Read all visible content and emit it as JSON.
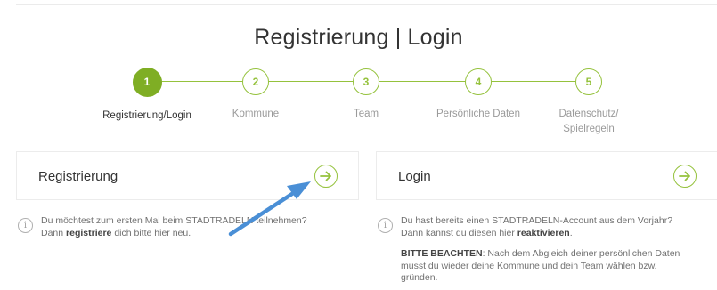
{
  "page": {
    "title": "Registrierung | Login"
  },
  "stepper": {
    "steps": [
      {
        "number": "1",
        "label": "Registrierung/Login",
        "active": true
      },
      {
        "number": "2",
        "label": "Kommune",
        "active": false
      },
      {
        "number": "3",
        "label": "Team",
        "active": false
      },
      {
        "number": "4",
        "label": "Persönliche Daten",
        "active": false
      },
      {
        "number": "5",
        "label_line1": "Datenschutz/",
        "label_line2": "Spielregeln",
        "active": false
      }
    ]
  },
  "registration": {
    "title": "Registrierung",
    "button_icon": "arrow-right-circle-icon",
    "info": {
      "icon": "info-icon",
      "line1": "Du möchtest zum ersten Mal beim STADTRADELN teilnehmen?",
      "line2_pre": "Dann ",
      "line2_bold": "registriere",
      "line2_post": " dich bitte hier neu."
    }
  },
  "login": {
    "title": "Login",
    "button_icon": "arrow-right-circle-icon",
    "info": {
      "icon": "info-icon",
      "line1": "Du hast bereits einen STADTRADELN-Account aus dem Vorjahr?",
      "line2_pre": "Dann kannst du diesen hier ",
      "line2_bold": "reaktivieren",
      "line2_post": ".",
      "note_bold": "BITTE BEACHTEN",
      "note_line1": ": Nach dem Abgleich deiner persönlichen Daten",
      "note_line2": "musst du wieder deine Kommune und dein Team wählen bzw.",
      "note_line3": "gründen."
    }
  },
  "colors": {
    "accent": "#95c23d",
    "accent_active": "#7fae24",
    "annotation_arrow": "#4a8fd6"
  }
}
